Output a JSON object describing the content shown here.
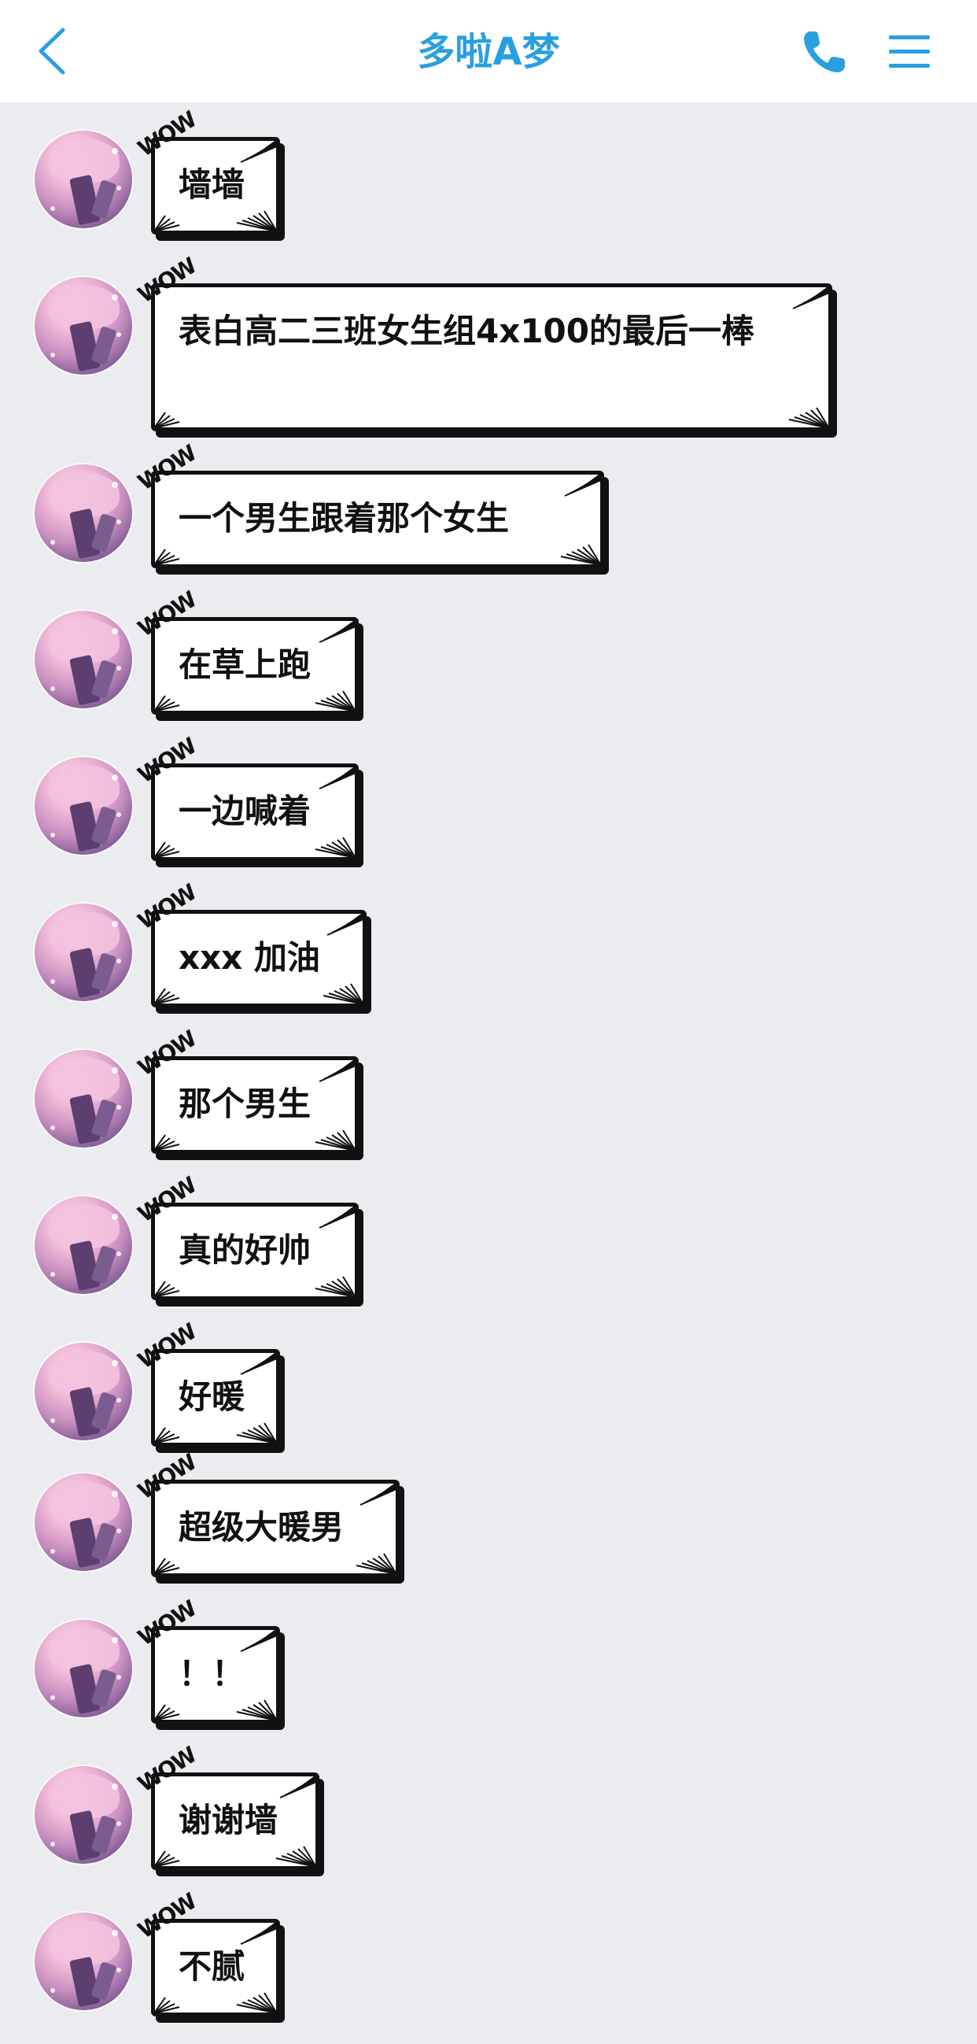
{
  "header": {
    "title": "多啦A梦",
    "back_icon": "chevron-left-icon",
    "phone_icon": "phone-icon",
    "menu_icon": "menu-icon",
    "accent_color": "#2a9fe0"
  },
  "bubble_sticker": "WOW",
  "messages": [
    {
      "text": "墙墙"
    },
    {
      "text": "表白高二三班女生组4x100的最后一棒"
    },
    {
      "text": "一个男生跟着那个女生"
    },
    {
      "text": "在草上跑"
    },
    {
      "text": "一边喊着"
    },
    {
      "text": "xxx 加油"
    },
    {
      "text": "那个男生"
    },
    {
      "text": "真的好帅"
    },
    {
      "text": "好暖"
    },
    {
      "text": "超级大暖男"
    },
    {
      "text": "！！"
    },
    {
      "text": "谢谢墙"
    },
    {
      "text": "不腻"
    }
  ]
}
